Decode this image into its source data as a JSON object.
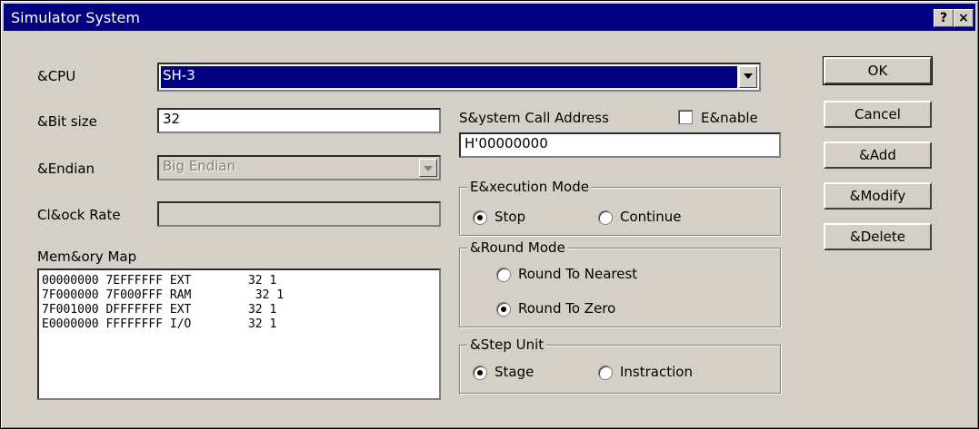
{
  "window": {
    "title": "Simulator System",
    "help_btn": "?",
    "close_btn": "×"
  },
  "fields": {
    "cpu": {
      "label": "&CPU",
      "value": "SH-3"
    },
    "bit_size": {
      "label": "&Bit size",
      "value": "32"
    },
    "endian": {
      "label": "&Endian",
      "value": "Big Endian"
    },
    "clock_rate": {
      "label": "Cl&ock Rate",
      "value": ""
    },
    "syscall": {
      "label": "S&ystem Call Address",
      "value": "H'00000000",
      "enable_label": "E&nable",
      "enabled": false
    }
  },
  "memory_map": {
    "label": "Mem&ory Map",
    "rows": [
      "00000000 7EFFFFFF EXT        32 1",
      "7F000000 7F000FFF RAM         32 1",
      "7F001000 DFFFFFFF EXT        32 1",
      "E0000000 FFFFFFFF I/O        32 1"
    ]
  },
  "execution_mode": {
    "title": "E&xecution Mode",
    "options": [
      "Stop",
      "Continue"
    ],
    "selected": "Stop"
  },
  "round_mode": {
    "title": "&Round Mode",
    "options": [
      "Round To Nearest",
      "Round To Zero"
    ],
    "selected": "Round To Zero"
  },
  "step_unit": {
    "title": "&Step Unit",
    "options": [
      "Stage",
      "Instraction"
    ],
    "selected": "Stage"
  },
  "buttons": {
    "ok": "OK",
    "cancel": "Cancel",
    "add": "&Add",
    "modify": "&Modify",
    "delete": "&Delete"
  }
}
